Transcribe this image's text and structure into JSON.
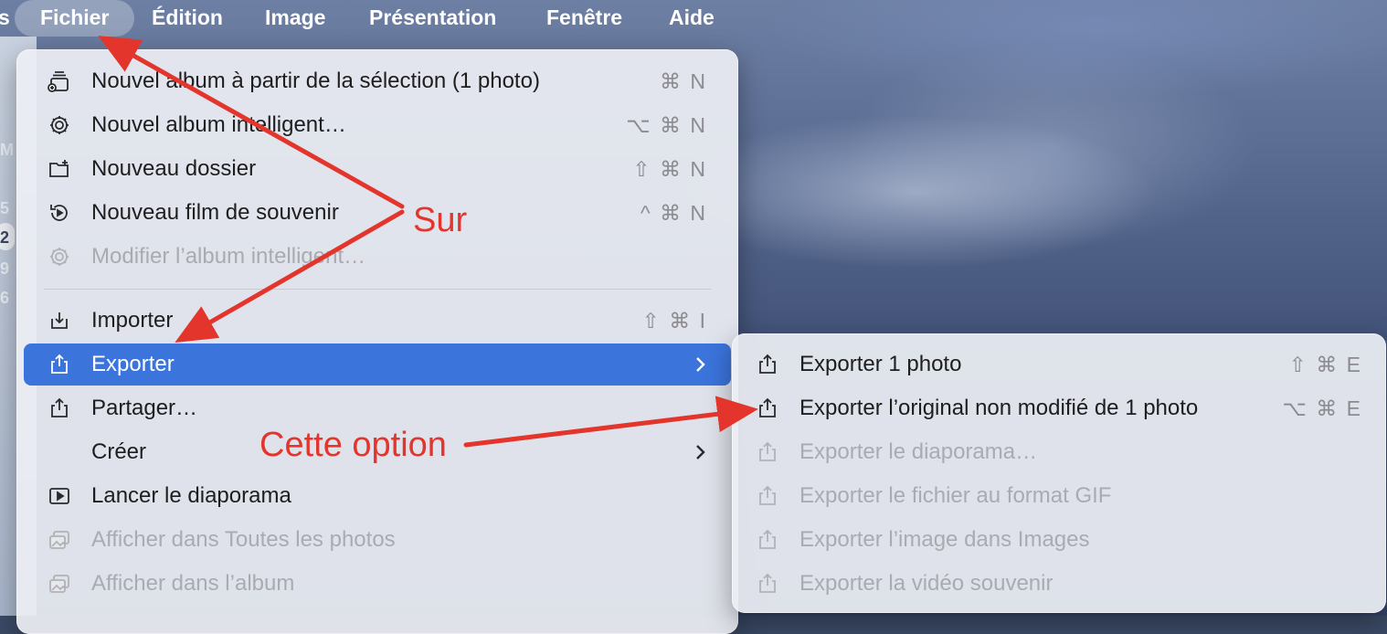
{
  "menubar": {
    "items": [
      "Fichier",
      "Édition",
      "Image",
      "Présentation",
      "Fenêtre",
      "Aide"
    ],
    "left_cut_text": "s"
  },
  "sidebar_edge": {
    "chars": [
      "M",
      "5",
      "2",
      "9",
      "6"
    ]
  },
  "file_menu": {
    "items": [
      {
        "label": "Nouvel album à partir de la sélection (1 photo)",
        "shortcut": "⌘ N",
        "icon": "stack-album-icon",
        "enabled": true
      },
      {
        "label": "Nouvel album intelligent…",
        "shortcut": "⌥ ⌘ N",
        "icon": "gear-icon",
        "enabled": true
      },
      {
        "label": "Nouveau dossier",
        "shortcut": "⇧ ⌘ N",
        "icon": "folder-plus-icon",
        "enabled": true
      },
      {
        "label": "Nouveau film de souvenir",
        "shortcut": "^ ⌘ N",
        "icon": "memory-icon",
        "enabled": true
      },
      {
        "label": "Modifier l’album intelligent…",
        "shortcut": "",
        "icon": "gear-icon",
        "enabled": false
      },
      {
        "label": "Importer",
        "shortcut": "⇧ ⌘ I",
        "icon": "import-icon",
        "enabled": true
      },
      {
        "label": "Exporter",
        "shortcut": "",
        "icon": "export-icon",
        "enabled": true,
        "highlighted": true,
        "submenu": true
      },
      {
        "label": "Partager…",
        "shortcut": "",
        "icon": "share-icon",
        "enabled": true
      },
      {
        "label": "Créer",
        "shortcut": "",
        "icon": "",
        "enabled": true,
        "submenu": true
      },
      {
        "label": "Lancer le diaporama",
        "shortcut": "",
        "icon": "play-icon",
        "enabled": true
      },
      {
        "label": "Afficher dans Toutes les photos",
        "shortcut": "",
        "icon": "photos-icon",
        "enabled": false
      },
      {
        "label": "Afficher dans l’album",
        "shortcut": "",
        "icon": "photos-icon",
        "enabled": false
      }
    ]
  },
  "export_submenu": {
    "items": [
      {
        "label": "Exporter 1 photo",
        "shortcut": "⇧ ⌘ E",
        "enabled": true
      },
      {
        "label": "Exporter l’original non modifié de 1 photo",
        "shortcut": "⌥ ⌘ E",
        "enabled": true
      },
      {
        "label": "Exporter le diaporama…",
        "shortcut": "",
        "enabled": false
      },
      {
        "label": "Exporter le fichier au format GIF",
        "shortcut": "",
        "enabled": false
      },
      {
        "label": "Exporter l’image dans Images",
        "shortcut": "",
        "enabled": false
      },
      {
        "label": "Exporter la vidéo souvenir",
        "shortcut": "",
        "enabled": false
      }
    ]
  },
  "annotations": {
    "sur": "Sur",
    "cette_option": "Cette option",
    "color": "#e3352b"
  },
  "colors": {
    "highlight": "#3b74db",
    "menu_text": "#1e1e1e",
    "disabled_text": "#a9abb1"
  }
}
